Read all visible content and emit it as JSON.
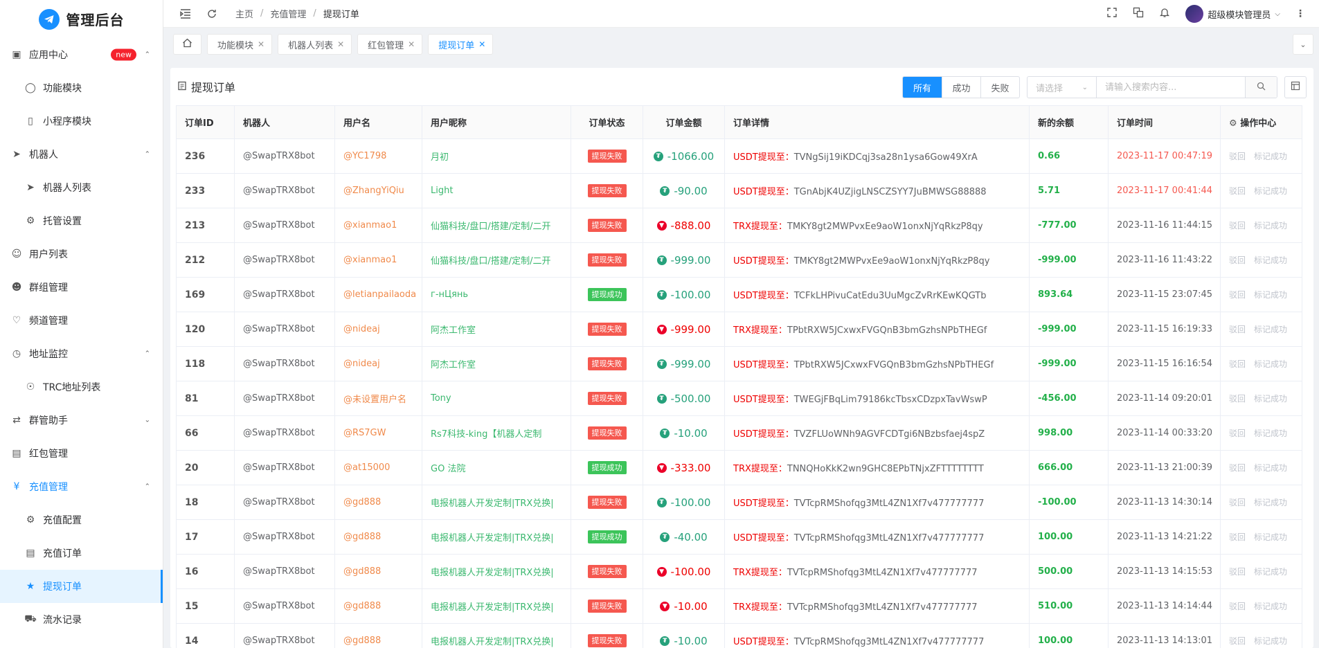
{
  "app": {
    "title": "管理后台"
  },
  "sidebar": {
    "items": [
      {
        "label": "应用中心",
        "icon": "app-icon",
        "badge": "new",
        "arrow": "up",
        "level": 0
      },
      {
        "label": "功能模块",
        "icon": "toggle-icon",
        "level": 1
      },
      {
        "label": "小程序模块",
        "icon": "phone-icon",
        "level": 1
      },
      {
        "label": "机器人",
        "icon": "send-icon",
        "arrow": "up",
        "level": 0
      },
      {
        "label": "机器人列表",
        "icon": "send-icon",
        "level": 1
      },
      {
        "label": "托管设置",
        "icon": "gears-icon",
        "level": 1
      },
      {
        "label": "用户列表",
        "icon": "user-icon",
        "level": 0
      },
      {
        "label": "群组管理",
        "icon": "group-icon",
        "level": 0
      },
      {
        "label": "频道管理",
        "icon": "heart-icon",
        "level": 0
      },
      {
        "label": "地址监控",
        "icon": "timer-icon",
        "arrow": "up",
        "level": 0
      },
      {
        "label": "TRC地址列表",
        "icon": "bulb-icon",
        "level": 1
      },
      {
        "label": "群管助手",
        "icon": "flow-icon",
        "arrow": "down",
        "level": 0
      },
      {
        "label": "红包管理",
        "icon": "calendar-icon",
        "level": 0
      },
      {
        "label": "充值管理",
        "icon": "yen-icon",
        "arrow": "up",
        "level": 0,
        "state": "active-parent"
      },
      {
        "label": "充值配置",
        "icon": "gears-icon",
        "level": 1
      },
      {
        "label": "充值订单",
        "icon": "doc-icon",
        "level": 1
      },
      {
        "label": "提现订单",
        "icon": "yen-circle-icon",
        "level": 1,
        "state": "active"
      },
      {
        "label": "流水记录",
        "icon": "cart-icon",
        "level": 1
      }
    ]
  },
  "header": {
    "breadcrumb": [
      "主页",
      "充值管理",
      "提现订单"
    ],
    "user_name": "超级模块管理员"
  },
  "tabs": [
    {
      "label": "功能模块"
    },
    {
      "label": "机器人列表"
    },
    {
      "label": "红包管理"
    },
    {
      "label": "提现订单",
      "active": true
    }
  ],
  "card": {
    "title": "提现订单",
    "filters": [
      "所有",
      "成功",
      "失败"
    ],
    "select_placeholder": "请选择",
    "search_placeholder": "请输入搜索内容..."
  },
  "table": {
    "columns": [
      "订单ID",
      "机器人",
      "用户名",
      "用户昵称",
      "订单状态",
      "订单金额",
      "订单详情",
      "新的余额",
      "订单时间",
      "操作中心"
    ],
    "op_labels": [
      "驳回",
      "标记成功"
    ],
    "rows": [
      {
        "id": "236",
        "bot": "@SwapTRX8bot",
        "user": "@YC1798",
        "nick": "月初",
        "status": "提现失败",
        "status_type": "fail",
        "coin": "usdt",
        "amount": "-1066.00",
        "detail_label": "USDT提现至：",
        "address": "TVNgSij19iKDCqj3sa28n1ysa6Gow49XrA",
        "balance": "0.66",
        "time": "2023-11-17 00:47:19",
        "time_red": true
      },
      {
        "id": "233",
        "bot": "@SwapTRX8bot",
        "user": "@ZhangYiQiu",
        "nick": "Light",
        "status": "提现失败",
        "status_type": "fail",
        "coin": "usdt",
        "amount": "-90.00",
        "detail_label": "USDT提现至：",
        "address": "TGnAbjK4UZjigLNSCZSYY7JuBMWSG88888",
        "balance": "5.71",
        "time": "2023-11-17 00:41:44",
        "time_red": true
      },
      {
        "id": "213",
        "bot": "@SwapTRX8bot",
        "user": "@xianmao1",
        "nick": "仙猫科技/盘口/搭建/定制/二开",
        "status": "提现失败",
        "status_type": "fail",
        "coin": "trx",
        "amount": "-888.00",
        "detail_label": "TRX提现至：",
        "address": "TMKY8gt2MWPvxEe9aoW1onxNjYqRkzP8qy",
        "balance": "-777.00",
        "time": "2023-11-16 11:44:15"
      },
      {
        "id": "212",
        "bot": "@SwapTRX8bot",
        "user": "@xianmao1",
        "nick": "仙猫科技/盘口/搭建/定制/二开",
        "status": "提现失败",
        "status_type": "fail",
        "coin": "usdt",
        "amount": "-999.00",
        "detail_label": "USDT提现至：",
        "address": "TMKY8gt2MWPvxEe9aoW1onxNjYqRkzP8qy",
        "balance": "-999.00",
        "time": "2023-11-16 11:43:22"
      },
      {
        "id": "169",
        "bot": "@SwapTRX8bot",
        "user": "@letianpailaoda",
        "nick": "г-нЦянь",
        "status": "提现成功",
        "status_type": "ok",
        "coin": "usdt",
        "amount": "-100.00",
        "detail_label": "USDT提现至：",
        "address": "TCFkLHPivuCatEdu3UuMgcZvRrKEwKQGTb",
        "balance": "893.64",
        "time": "2023-11-15 23:07:45"
      },
      {
        "id": "120",
        "bot": "@SwapTRX8bot",
        "user": "@nideaj",
        "nick": "阿杰工作室",
        "status": "提现失败",
        "status_type": "fail",
        "coin": "trx",
        "amount": "-999.00",
        "detail_label": "TRX提现至：",
        "address": "TPbtRXW5JCxwxFVGQnB3bmGzhsNPbTHEGf",
        "balance": "-999.00",
        "time": "2023-11-15 16:19:33"
      },
      {
        "id": "118",
        "bot": "@SwapTRX8bot",
        "user": "@nideaj",
        "nick": "阿杰工作室",
        "status": "提现失败",
        "status_type": "fail",
        "coin": "usdt",
        "amount": "-999.00",
        "detail_label": "USDT提现至：",
        "address": "TPbtRXW5JCxwxFVGQnB3bmGzhsNPbTHEGf",
        "balance": "-999.00",
        "time": "2023-11-15 16:16:54"
      },
      {
        "id": "81",
        "bot": "@SwapTRX8bot",
        "user": "@未设置用户名",
        "nick": "Tony",
        "status": "提现失败",
        "status_type": "fail",
        "coin": "usdt",
        "amount": "-500.00",
        "detail_label": "USDT提现至：",
        "address": "TWEGjFBqLim79186kcTbsxCDzpxTavWswP",
        "balance": "-456.00",
        "time": "2023-11-14 09:20:01"
      },
      {
        "id": "66",
        "bot": "@SwapTRX8bot",
        "user": "@RS7GW",
        "nick": "Rs7科技-king【机器人定制",
        "status": "提现失败",
        "status_type": "fail",
        "coin": "usdt",
        "amount": "-10.00",
        "detail_label": "USDT提现至：",
        "address": "TVZFLUoWNh9AGVFCDTgi6NBzbsfaej4spZ",
        "balance": "998.00",
        "time": "2023-11-14 00:33:20"
      },
      {
        "id": "20",
        "bot": "@SwapTRX8bot",
        "user": "@at15000",
        "nick": "GO 法院",
        "status": "提现成功",
        "status_type": "ok",
        "coin": "trx",
        "amount": "-333.00",
        "detail_label": "TRX提现至：",
        "address": "TNNQHoKkK2wn9GHC8EPbTNjxZFTTTTTTTT",
        "balance": "666.00",
        "time": "2023-11-13 21:00:39"
      },
      {
        "id": "18",
        "bot": "@SwapTRX8bot",
        "user": "@gd888",
        "nick": "电报机器人开发定制|TRX兑换|",
        "status": "提现失败",
        "status_type": "fail",
        "coin": "usdt",
        "amount": "-100.00",
        "detail_label": "USDT提现至：",
        "address": "TVTcpRMShofqg3MtL4ZN1Xf7v477777777",
        "balance": "-100.00",
        "time": "2023-11-13 14:30:14"
      },
      {
        "id": "17",
        "bot": "@SwapTRX8bot",
        "user": "@gd888",
        "nick": "电报机器人开发定制|TRX兑换|",
        "status": "提现成功",
        "status_type": "ok",
        "coin": "usdt",
        "amount": "-40.00",
        "detail_label": "USDT提现至：",
        "address": "TVTcpRMShofqg3MtL4ZN1Xf7v477777777",
        "balance": "100.00",
        "time": "2023-11-13 14:21:22"
      },
      {
        "id": "16",
        "bot": "@SwapTRX8bot",
        "user": "@gd888",
        "nick": "电报机器人开发定制|TRX兑换|",
        "status": "提现失败",
        "status_type": "fail",
        "coin": "trx",
        "amount": "-100.00",
        "detail_label": "TRX提现至：",
        "address": "TVTcpRMShofqg3MtL4ZN1Xf7v477777777",
        "balance": "500.00",
        "time": "2023-11-13 14:15:53"
      },
      {
        "id": "15",
        "bot": "@SwapTRX8bot",
        "user": "@gd888",
        "nick": "电报机器人开发定制|TRX兑换|",
        "status": "提现失败",
        "status_type": "fail",
        "coin": "trx",
        "amount": "-10.00",
        "detail_label": "TRX提现至：",
        "address": "TVTcpRMShofqg3MtL4ZN1Xf7v477777777",
        "balance": "510.00",
        "time": "2023-11-13 14:14:44"
      },
      {
        "id": "14",
        "bot": "@SwapTRX8bot",
        "user": "@gd888",
        "nick": "电报机器人开发定制|TRX兑换|",
        "status": "提现失败",
        "status_type": "fail",
        "coin": "usdt",
        "amount": "-10.00",
        "detail_label": "USDT提现至：",
        "address": "TVTcpRMShofqg3MtL4ZN1Xf7v477777777",
        "balance": "100.00",
        "time": "2023-11-13 14:13:01"
      }
    ]
  }
}
